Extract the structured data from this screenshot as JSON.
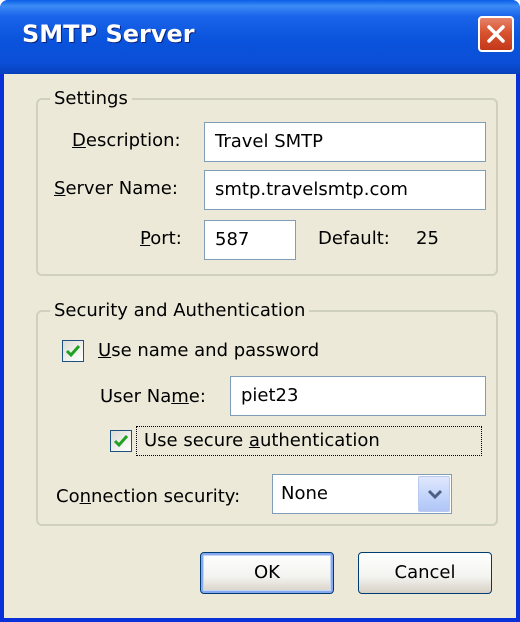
{
  "window": {
    "title": "SMTP Server",
    "close_icon": "close-icon"
  },
  "settings": {
    "group_label": "Settings",
    "description": {
      "label_pre": "",
      "label_ul": "D",
      "label_post": "escription:",
      "value": "Travel SMTP"
    },
    "server_name": {
      "label_pre": "",
      "label_ul": "S",
      "label_post": "erver Name:",
      "value": "smtp.travelsmtp.com"
    },
    "port": {
      "label_pre": "",
      "label_ul": "P",
      "label_post": "ort:",
      "value": "587",
      "default_label": "Default:",
      "default_value": "25"
    }
  },
  "security": {
    "group_label": "Security and Authentication",
    "use_name_password": {
      "label_pre": "",
      "label_ul": "U",
      "label_post": "se name and password",
      "checked": true
    },
    "user_name": {
      "label_pre": "User Na",
      "label_ul": "m",
      "label_post": "e:",
      "value": "piet23"
    },
    "secure_auth": {
      "label_pre": "Use secure ",
      "label_ul": "a",
      "label_post": "uthentication",
      "checked": true
    },
    "connection_security": {
      "label_pre": "Co",
      "label_ul": "n",
      "label_post": "nection security:",
      "selected": "None"
    }
  },
  "buttons": {
    "ok": "OK",
    "cancel": "Cancel"
  },
  "colors": {
    "titlebar": "#0a53dc",
    "dialog_bg": "#ece9d8",
    "check": "#21a121",
    "close": "#d8532f"
  }
}
